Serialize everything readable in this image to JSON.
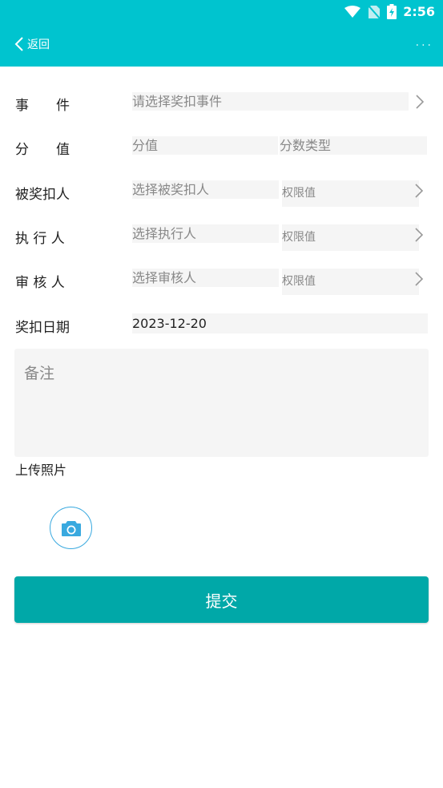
{
  "status_bar": {
    "time": "2:56"
  },
  "header": {
    "back_label": "返回",
    "more_label": "..."
  },
  "form": {
    "event": {
      "label": "事　　件",
      "placeholder": "请选择奖扣事件"
    },
    "score": {
      "label": "分　　值",
      "placeholder": "分值",
      "type_placeholder": "分数类型"
    },
    "target_person": {
      "label": "被奖扣人",
      "placeholder": "选择被奖扣人",
      "permission_placeholder": "权限值"
    },
    "executor": {
      "label": "执 行 人",
      "placeholder": "选择执行人",
      "permission_placeholder": "权限值"
    },
    "reviewer": {
      "label": "审 核 人",
      "placeholder": "选择审核人",
      "permission_placeholder": "权限值"
    },
    "date": {
      "label": "奖扣日期",
      "value": "2023-12-20"
    },
    "remark": {
      "placeholder": "备注"
    },
    "upload": {
      "label": "上传照片"
    }
  },
  "submit": {
    "label": "提交"
  },
  "colors": {
    "header": "#00c4cf",
    "submit": "#00a8a8",
    "camera": "#39a9df",
    "field_bg": "#f5f5f5"
  }
}
